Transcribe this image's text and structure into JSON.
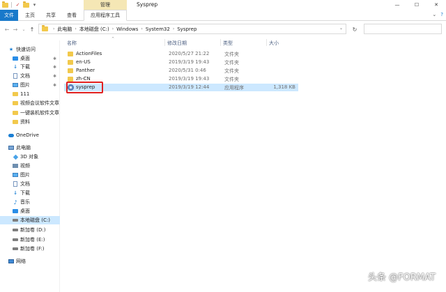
{
  "titlebar": {
    "manage_tab": "管理",
    "title": "Sysprep",
    "controls": [
      "—",
      "☐",
      "✕"
    ]
  },
  "ribbon": {
    "tabs": [
      "文件",
      "主页",
      "共享",
      "查看",
      "应用程序工具"
    ],
    "right_icons": [
      "chevron-down-icon",
      "help-icon"
    ]
  },
  "address": {
    "crumbs": [
      "此电脑",
      "本地磁盘 (C:)",
      "Windows",
      "System32",
      "Sysprep"
    ]
  },
  "sidebar": {
    "items": [
      {
        "label": "快速访问",
        "icon": "star-icon",
        "pinned": false
      },
      {
        "label": "桌面",
        "icon": "desktop-icon",
        "pinned": true
      },
      {
        "label": "下载",
        "icon": "download-icon",
        "pinned": true
      },
      {
        "label": "文档",
        "icon": "document-icon",
        "pinned": true
      },
      {
        "label": "图片",
        "icon": "picture-icon",
        "pinned": true
      },
      {
        "label": "111",
        "icon": "folder-icon",
        "pinned": false
      },
      {
        "label": "视频会议软件文章",
        "icon": "folder-icon",
        "pinned": false
      },
      {
        "label": "一键装机软件文章",
        "icon": "folder-icon",
        "pinned": false
      },
      {
        "label": "资料",
        "icon": "folder-icon",
        "pinned": false
      },
      {
        "label": "OneDrive",
        "icon": "cloud-icon",
        "pinned": false
      },
      {
        "label": "此电脑",
        "icon": "computer-icon",
        "pinned": false
      },
      {
        "label": "3D 对象",
        "icon": "cube-icon",
        "pinned": false
      },
      {
        "label": "视频",
        "icon": "video-icon",
        "pinned": false
      },
      {
        "label": "图片",
        "icon": "picture-icon",
        "pinned": false
      },
      {
        "label": "文档",
        "icon": "document-icon",
        "pinned": false
      },
      {
        "label": "下载",
        "icon": "download-icon",
        "pinned": false
      },
      {
        "label": "音乐",
        "icon": "music-icon",
        "pinned": false
      },
      {
        "label": "桌面",
        "icon": "desktop-icon",
        "pinned": false
      },
      {
        "label": "本地磁盘 (C:)",
        "icon": "drive-icon",
        "pinned": false,
        "selected": true
      },
      {
        "label": "新加卷 (D:)",
        "icon": "drive-icon",
        "pinned": false
      },
      {
        "label": "新加卷 (E:)",
        "icon": "drive-icon",
        "pinned": false
      },
      {
        "label": "新加卷 (F:)",
        "icon": "drive-icon",
        "pinned": false
      },
      {
        "label": "网络",
        "icon": "network-icon",
        "pinned": false
      }
    ]
  },
  "list": {
    "columns": {
      "name": "名称",
      "date": "修改日期",
      "type": "类型",
      "size": "大小"
    },
    "rows": [
      {
        "name": "ActionFiles",
        "date": "2020/5/27 21:22",
        "type": "文件夹",
        "size": "",
        "icon": "folder-icon"
      },
      {
        "name": "en-US",
        "date": "2019/3/19 19:43",
        "type": "文件夹",
        "size": "",
        "icon": "folder-icon"
      },
      {
        "name": "Panther",
        "date": "2020/5/31 0:46",
        "type": "文件夹",
        "size": "",
        "icon": "folder-icon"
      },
      {
        "name": "zh-CN",
        "date": "2019/3/19 19:43",
        "type": "文件夹",
        "size": "",
        "icon": "folder-icon"
      },
      {
        "name": "sysprep",
        "date": "2019/3/19 12:44",
        "type": "应用程序",
        "size": "1,318 KB",
        "icon": "application-icon",
        "selected": true
      }
    ]
  },
  "watermark": "头条 @FORMAT",
  "colors": {
    "accent": "#1979ca",
    "selection": "#cce8ff",
    "manage_tab": "#f5e7b5",
    "highlight_box": "#e02020"
  }
}
